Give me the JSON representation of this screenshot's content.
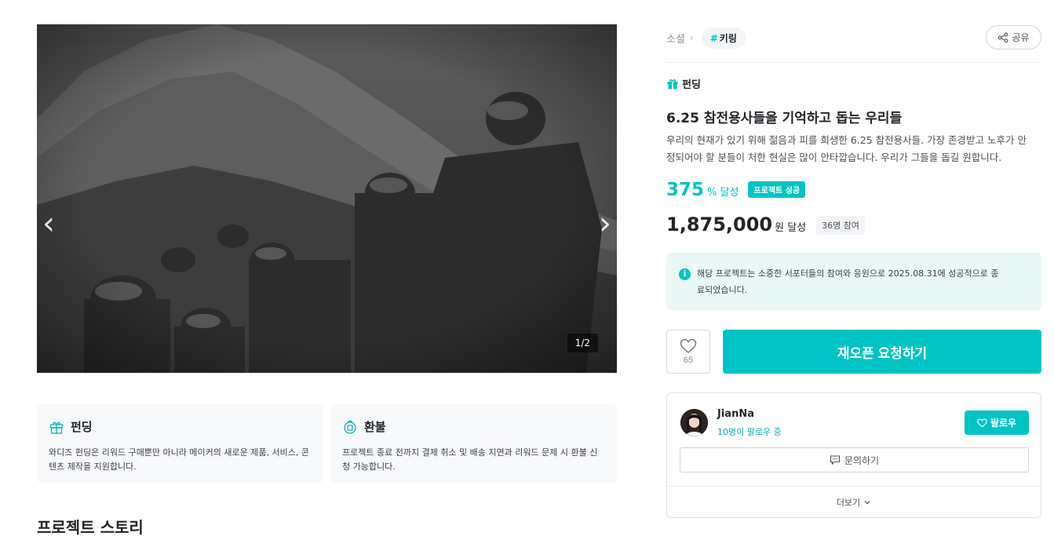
{
  "hero": {
    "counter": "1/2",
    "prev_arrow": "‹",
    "next_arrow": "›"
  },
  "info_cards": [
    {
      "icon": "gift-icon",
      "title": "펀딩",
      "body": "와디즈 펀딩은 리워드 구매뿐만 아니라 메이커의 새로운 제품, 서비스, 콘텐츠 제작을 지원합니다."
    },
    {
      "icon": "refund-icon",
      "title": "환불",
      "body": "프로젝트 종료 전까지 결제 취소 및 배송 지연과 리워드 문제 시 환불 신청 가능합니다."
    }
  ],
  "story_title": "프로젝트 스토리",
  "breadcrumb": {
    "category": "소셜",
    "tag_hash": "#",
    "tag": "키링"
  },
  "share_label": "공유",
  "type_label": "펀딩",
  "project": {
    "title": "6.25 참전용사들을 기억하고 돕는 우리들",
    "description": "우리의 현재가 있기 위해 젊음과 피를 희생한 6.25 참전용사들. 가장 존경받고 노후가 안정되어야 할 분들이 처한 현실은 많이 안타깝습니다. 우리가 그들을 돕길 원합니다."
  },
  "achievement": {
    "percent": "375",
    "percent_unit": "% 달성",
    "badge": "프로젝트 성공"
  },
  "amount": {
    "value": "1,875,000",
    "unit": "원 달성",
    "participants": "36명 참여"
  },
  "notice": {
    "icon_glyph": "i",
    "text": "해당 프로젝트는 소중한 서포터들의 참여와 응원으로 2025.08.31에 성공적으로 종료되었습니다."
  },
  "like": {
    "count": "65"
  },
  "reopen_label": "재오픈 요청하기",
  "maker": {
    "name": "JianNa",
    "followers": "10명이 팔로우 중",
    "follow_label": "팔로우",
    "inquiry_label": "문의하기",
    "more_label": "더보기"
  },
  "colors": {
    "accent": "#00c4c4",
    "notice_bg": "#e9f7f7",
    "card_bg": "#f7f8fa"
  }
}
